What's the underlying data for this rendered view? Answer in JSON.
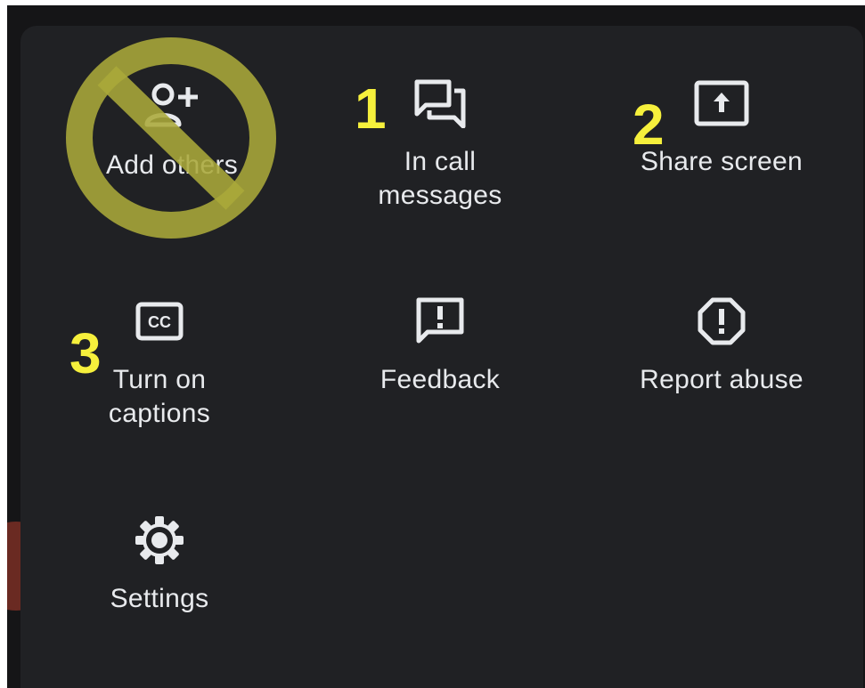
{
  "menu": {
    "items": [
      {
        "label": "Add others",
        "icon": "person-add-icon"
      },
      {
        "label": "In call\nmessages",
        "icon": "chat-icon"
      },
      {
        "label": "Share screen",
        "icon": "present-screen-icon"
      },
      {
        "label": "Turn on\ncaptions",
        "icon": "closed-captions-icon"
      },
      {
        "label": "Feedback",
        "icon": "feedback-icon"
      },
      {
        "label": "Report abuse",
        "icon": "report-icon"
      },
      {
        "label": "Settings",
        "icon": "gear-icon"
      }
    ]
  },
  "annotations": {
    "one": "1",
    "two": "2",
    "three": "3",
    "prohibited_icon": "no-symbol-overlay",
    "color": "#f6f03c",
    "overlay_color": "#aaa83a"
  },
  "colors": {
    "panel_background": "#202124",
    "text": "#e8eaed"
  }
}
